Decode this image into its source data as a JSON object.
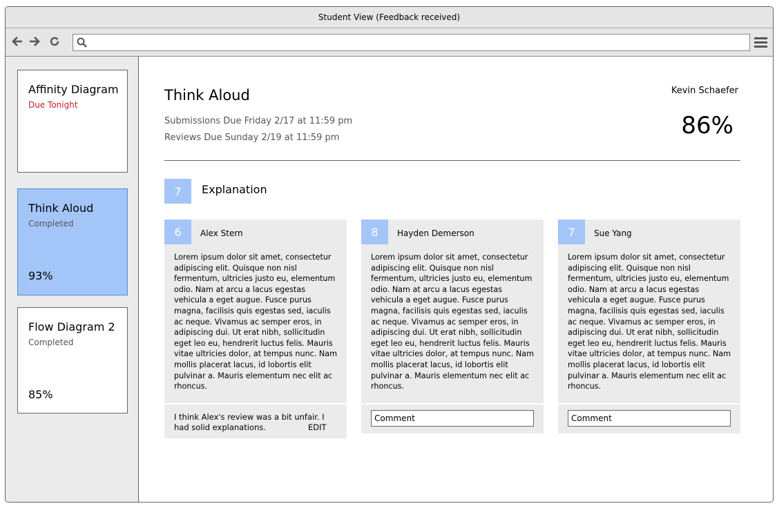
{
  "window": {
    "title": "Student View (Feedback received)"
  },
  "toolbar": {
    "back_icon": "back-arrow-icon",
    "forward_icon": "forward-arrow-icon",
    "reload_icon": "reload-icon",
    "url_value": "",
    "search_icon": "search-icon",
    "menu_icon": "hamburger-menu-icon"
  },
  "sidebar": {
    "items": [
      {
        "title": "Affinity Diagram",
        "status": "Due Tonight",
        "score": ""
      },
      {
        "title": "Think Aloud",
        "status": "Completed",
        "score": "93%"
      },
      {
        "title": "Flow Diagram 2",
        "status": "Completed",
        "score": "85%"
      }
    ]
  },
  "assignment": {
    "title": "Think Aloud",
    "submissions_due": "Submissions Due Friday 2/17 at 11:59 pm",
    "reviews_due": "Reviews Due Sunday 2/19 at 11:59 pm",
    "student_name": "Kevin Schaefer",
    "grade": "86%"
  },
  "section": {
    "score": "7",
    "title": "Explanation"
  },
  "reviews": [
    {
      "score": "6",
      "reviewer": "Alex Stern",
      "text": "Lorem ipsum dolor sit amet, consectetur adipiscing elit. Quisque non nisl fermentum, ultricies justo eu, elementum odio. Nam at arcu a lacus egestas vehicula a eget augue. Fusce purus magna, facilisis quis egestas sed, iaculis ac neque. Vivamus ac semper eros, in adipiscing dui. Ut erat nibh, sollicitudin eget leo eu, hendrerit luctus felis. Mauris vitae ultricies dolor, at tempus nunc. Nam mollis placerat lacus, id lobortis elit pulvinar a. Mauris elementum nec elit ac rhoncus.",
      "feedback": "I think Alex's review was a bit unfair. I had solid explanations.",
      "edit_label": "EDIT"
    },
    {
      "score": "8",
      "reviewer": "Hayden Demerson",
      "text": "Lorem ipsum dolor sit amet, consectetur adipiscing elit. Quisque non nisl fermentum, ultricies justo eu, elementum odio. Nam at arcu a lacus egestas vehicula a eget augue. Fusce purus magna, facilisis quis egestas sed, iaculis ac neque. Vivamus ac semper eros, in adipiscing dui. Ut erat nibh, sollicitudin eget leo eu, hendrerit luctus felis. Mauris vitae ultricies dolor, at tempus nunc. Nam mollis placerat lacus, id lobortis elit pulvinar a. Mauris elementum nec elit ac rhoncus.",
      "comment_value": "Comment"
    },
    {
      "score": "7",
      "reviewer": "Sue Yang",
      "text": "Lorem ipsum dolor sit amet, consectetur adipiscing elit. Quisque non nisl fermentum, ultricies justo eu, elementum odio. Nam at arcu a lacus egestas vehicula a eget augue. Fusce purus magna, facilisis quis egestas sed, iaculis ac neque. Vivamus ac semper eros, in adipiscing dui. Ut erat nibh, sollicitudin eget leo eu, hendrerit luctus felis. Mauris vitae ultricies dolor, at tempus nunc. Nam mollis placerat lacus, id lobortis elit pulvinar a. Mauris elementum nec elit ac rhoncus.",
      "comment_value": "Comment"
    }
  ],
  "colors": {
    "accent": "#a3c5f8",
    "due_warning": "#c42020",
    "panel_gray": "#ebebeb"
  }
}
